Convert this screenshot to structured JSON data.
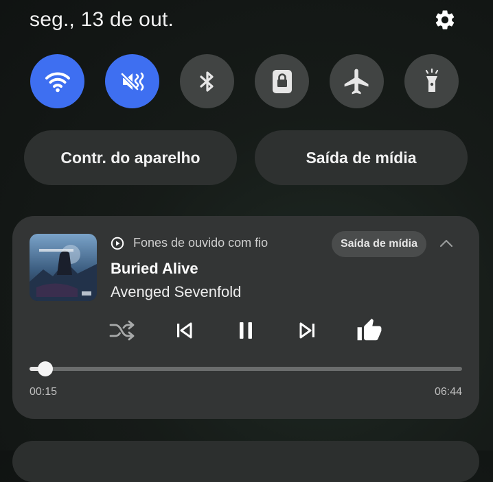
{
  "header": {
    "date": "seg., 13 de out."
  },
  "quick_settings": [
    {
      "icon": "wifi-icon",
      "active": true
    },
    {
      "icon": "mute-vibrate-icon",
      "active": true
    },
    {
      "icon": "bluetooth-icon",
      "active": false
    },
    {
      "icon": "rotation-lock-icon",
      "active": false
    },
    {
      "icon": "airplane-mode-icon",
      "active": false
    },
    {
      "icon": "flashlight-icon",
      "active": false
    }
  ],
  "pills": {
    "device_control": "Contr. do aparelho",
    "media_output": "Saída de mídia"
  },
  "media": {
    "source": "Fones de ouvido com fio",
    "output_chip": "Saída de mídia",
    "title": "Buried Alive",
    "artist": "Avenged Sevenfold",
    "elapsed": "00:15",
    "duration": "06:44",
    "progress_fraction": 0.037
  },
  "colors": {
    "accent": "#3e6ff1",
    "tile_off": "#414443",
    "card": "#333535"
  }
}
